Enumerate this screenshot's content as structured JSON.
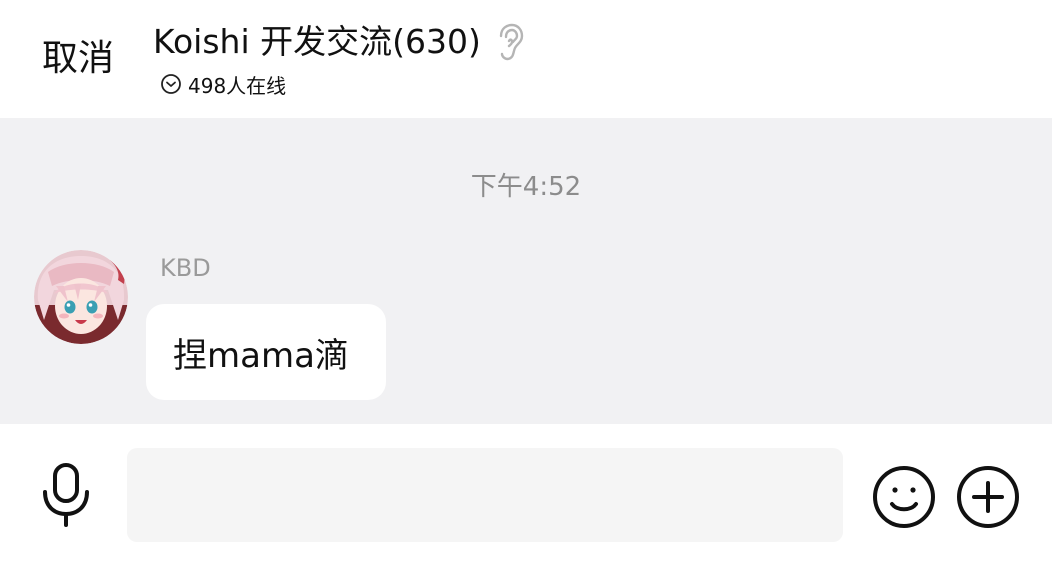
{
  "header": {
    "cancel_label": "取消",
    "title": "Koishi 开发交流(630)",
    "online_status": "498人在线",
    "icons": [
      "ear-icon",
      "chevron-down-circle-icon"
    ]
  },
  "chat": {
    "timestamp": "下午4:52",
    "messages": [
      {
        "sender": "KBD",
        "text": "捏mama滴",
        "avatar": "anime-avatar-pink-hair"
      }
    ]
  },
  "input_bar": {
    "placeholder": "",
    "icons": [
      "microphone-icon",
      "emoji-icon",
      "plus-icon"
    ]
  },
  "colors": {
    "chat_background": "#f1f1f3",
    "bubble": "#ffffff",
    "timestamp": "#8c8c8c",
    "sender_name": "#9a9a9a",
    "input_field": "#f5f5f5"
  }
}
